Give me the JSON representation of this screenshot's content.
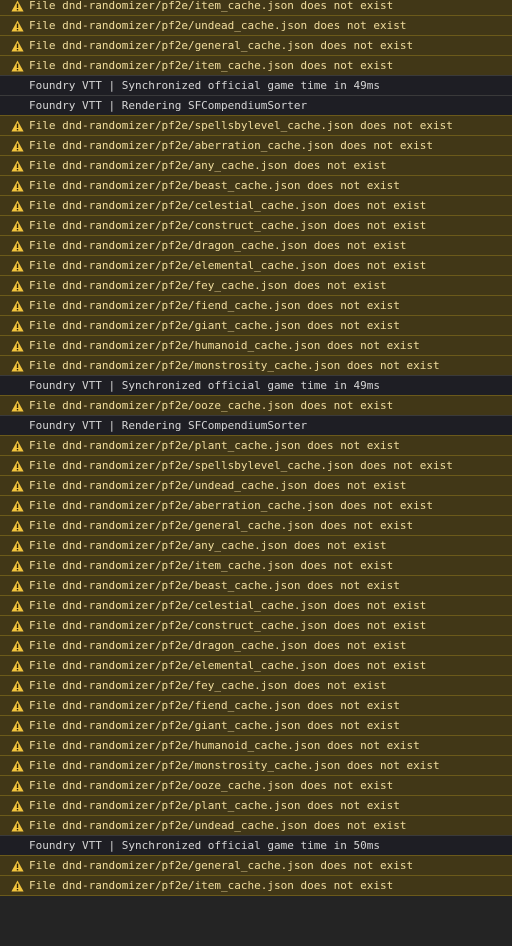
{
  "icons": {
    "warning": "warning-triangle-icon"
  },
  "colors": {
    "warning_bg": "#413717",
    "warning_text": "#f0dc9c",
    "warning_icon": "#f2c43d",
    "info_bg": "#1e1e24",
    "info_text": "#d4d4d4"
  },
  "console": {
    "messages": [
      {
        "level": "warning",
        "text": "File dnd-randomizer/pf2e/item_cache.json does not exist"
      },
      {
        "level": "warning",
        "text": "File dnd-randomizer/pf2e/undead_cache.json does not exist"
      },
      {
        "level": "warning",
        "text": "File dnd-randomizer/pf2e/general_cache.json does not exist"
      },
      {
        "level": "warning",
        "text": "File dnd-randomizer/pf2e/item_cache.json does not exist"
      },
      {
        "level": "info",
        "text": "Foundry VTT | Synchronized official game time in 49ms"
      },
      {
        "level": "info",
        "text": "Foundry VTT | Rendering SFCompendiumSorter"
      },
      {
        "level": "warning",
        "text": "File dnd-randomizer/pf2e/spellsbylevel_cache.json does not exist"
      },
      {
        "level": "warning",
        "text": "File dnd-randomizer/pf2e/aberration_cache.json does not exist"
      },
      {
        "level": "warning",
        "text": "File dnd-randomizer/pf2e/any_cache.json does not exist"
      },
      {
        "level": "warning",
        "text": "File dnd-randomizer/pf2e/beast_cache.json does not exist"
      },
      {
        "level": "warning",
        "text": "File dnd-randomizer/pf2e/celestial_cache.json does not exist"
      },
      {
        "level": "warning",
        "text": "File dnd-randomizer/pf2e/construct_cache.json does not exist"
      },
      {
        "level": "warning",
        "text": "File dnd-randomizer/pf2e/dragon_cache.json does not exist"
      },
      {
        "level": "warning",
        "text": "File dnd-randomizer/pf2e/elemental_cache.json does not exist"
      },
      {
        "level": "warning",
        "text": "File dnd-randomizer/pf2e/fey_cache.json does not exist"
      },
      {
        "level": "warning",
        "text": "File dnd-randomizer/pf2e/fiend_cache.json does not exist"
      },
      {
        "level": "warning",
        "text": "File dnd-randomizer/pf2e/giant_cache.json does not exist"
      },
      {
        "level": "warning",
        "text": "File dnd-randomizer/pf2e/humanoid_cache.json does not exist"
      },
      {
        "level": "warning",
        "text": "File dnd-randomizer/pf2e/monstrosity_cache.json does not exist"
      },
      {
        "level": "info",
        "text": "Foundry VTT | Synchronized official game time in 49ms"
      },
      {
        "level": "warning",
        "text": "File dnd-randomizer/pf2e/ooze_cache.json does not exist"
      },
      {
        "level": "info",
        "text": "Foundry VTT | Rendering SFCompendiumSorter"
      },
      {
        "level": "warning",
        "text": "File dnd-randomizer/pf2e/plant_cache.json does not exist"
      },
      {
        "level": "warning",
        "text": "File dnd-randomizer/pf2e/spellsbylevel_cache.json does not exist"
      },
      {
        "level": "warning",
        "text": "File dnd-randomizer/pf2e/undead_cache.json does not exist"
      },
      {
        "level": "warning",
        "text": "File dnd-randomizer/pf2e/aberration_cache.json does not exist"
      },
      {
        "level": "warning",
        "text": "File dnd-randomizer/pf2e/general_cache.json does not exist"
      },
      {
        "level": "warning",
        "text": "File dnd-randomizer/pf2e/any_cache.json does not exist"
      },
      {
        "level": "warning",
        "text": "File dnd-randomizer/pf2e/item_cache.json does not exist"
      },
      {
        "level": "warning",
        "text": "File dnd-randomizer/pf2e/beast_cache.json does not exist"
      },
      {
        "level": "warning",
        "text": "File dnd-randomizer/pf2e/celestial_cache.json does not exist"
      },
      {
        "level": "warning",
        "text": "File dnd-randomizer/pf2e/construct_cache.json does not exist"
      },
      {
        "level": "warning",
        "text": "File dnd-randomizer/pf2e/dragon_cache.json does not exist"
      },
      {
        "level": "warning",
        "text": "File dnd-randomizer/pf2e/elemental_cache.json does not exist"
      },
      {
        "level": "warning",
        "text": "File dnd-randomizer/pf2e/fey_cache.json does not exist"
      },
      {
        "level": "warning",
        "text": "File dnd-randomizer/pf2e/fiend_cache.json does not exist"
      },
      {
        "level": "warning",
        "text": "File dnd-randomizer/pf2e/giant_cache.json does not exist"
      },
      {
        "level": "warning",
        "text": "File dnd-randomizer/pf2e/humanoid_cache.json does not exist"
      },
      {
        "level": "warning",
        "text": "File dnd-randomizer/pf2e/monstrosity_cache.json does not exist"
      },
      {
        "level": "warning",
        "text": "File dnd-randomizer/pf2e/ooze_cache.json does not exist"
      },
      {
        "level": "warning",
        "text": "File dnd-randomizer/pf2e/plant_cache.json does not exist"
      },
      {
        "level": "warning",
        "text": "File dnd-randomizer/pf2e/undead_cache.json does not exist"
      },
      {
        "level": "info",
        "text": "Foundry VTT | Synchronized official game time in 50ms"
      },
      {
        "level": "warning",
        "text": "File dnd-randomizer/pf2e/general_cache.json does not exist"
      },
      {
        "level": "warning",
        "text": "File dnd-randomizer/pf2e/item_cache.json does not exist"
      }
    ]
  }
}
